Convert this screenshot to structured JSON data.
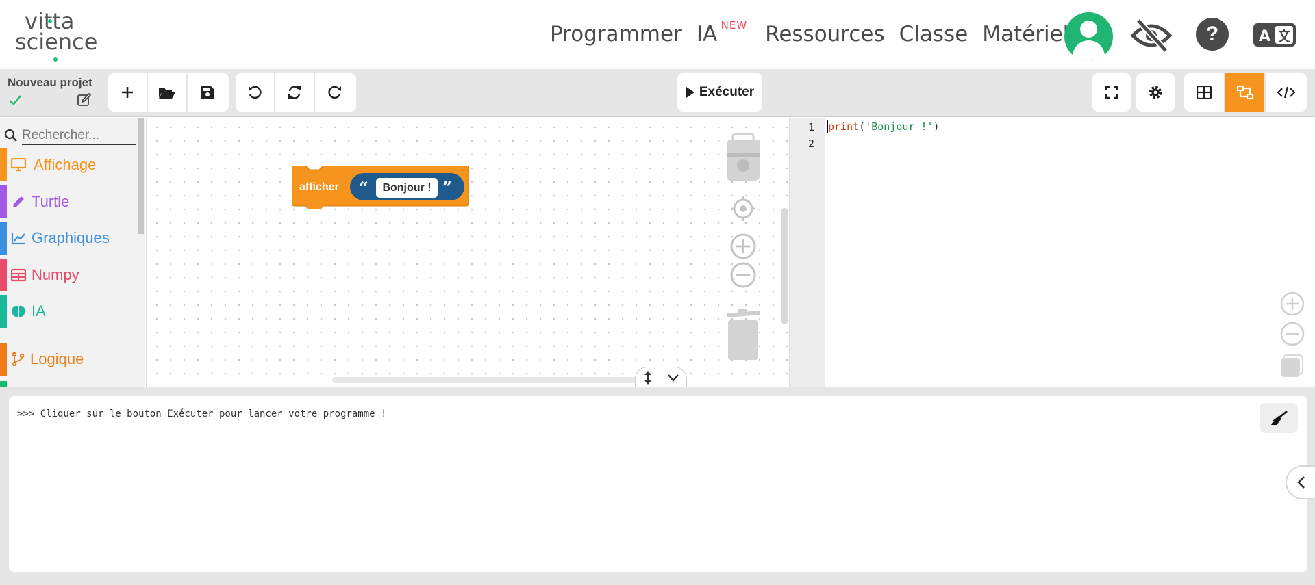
{
  "navbar": {
    "logo_line1": "vitta",
    "logo_line2": "science",
    "links": [
      "Programmer",
      "IA",
      "Ressources",
      "Classe",
      "Matériel"
    ],
    "ia_badge": "NEW",
    "help_label": "?",
    "colors": {
      "accent": "#21b573",
      "badge": "#e94b5b",
      "icon_dark": "#4a4a4a"
    },
    "icons": [
      "user-avatar-icon",
      "eye-slash-icon",
      "question-icon",
      "translate-icon"
    ]
  },
  "toolbar": {
    "project_name": "Nouveau projet",
    "run_label": "Exécuter",
    "icons": [
      "check-icon",
      "edit-icon",
      "plus-icon",
      "folder-open-icon",
      "save-icon",
      "undo-icon",
      "sync-icon",
      "redo-icon",
      "play-icon",
      "fullscreen-icon",
      "gear-icon",
      "grid-icon",
      "blocks-code-icon",
      "code-icon"
    ],
    "active_color": "#f7941d"
  },
  "sidebar": {
    "search_placeholder": "Rechercher...",
    "categories": [
      {
        "label": "Affichage",
        "color": "#f7941d",
        "icon": "monitor-icon"
      },
      {
        "label": "Turtle",
        "color": "#a259e6",
        "icon": "pencil-icon"
      },
      {
        "label": "Graphiques",
        "color": "#3d8fe0",
        "icon": "line-chart-icon"
      },
      {
        "label": "Numpy",
        "color": "#e94b6a",
        "icon": "table-icon"
      },
      {
        "label": "IA",
        "color": "#1ab89a",
        "icon": "brain-icon"
      },
      {
        "label": "Logique",
        "color": "#f07d1a",
        "icon": "branch-icon"
      }
    ]
  },
  "workspace": {
    "block_label": "afficher",
    "block_text": "Bonjour !",
    "quote_open": "“",
    "quote_close": "”",
    "block_color": "#f7941d",
    "text_wrapper_color": "#1e5a8c"
  },
  "editor": {
    "line_numbers": [
      "1",
      "2"
    ],
    "code_fn": "print",
    "code_open": "(",
    "code_str": "'Bonjour !'",
    "code_close": ")"
  },
  "console": {
    "message": ">>> Cliquer sur le bouton Exécuter pour lancer votre programme !"
  }
}
